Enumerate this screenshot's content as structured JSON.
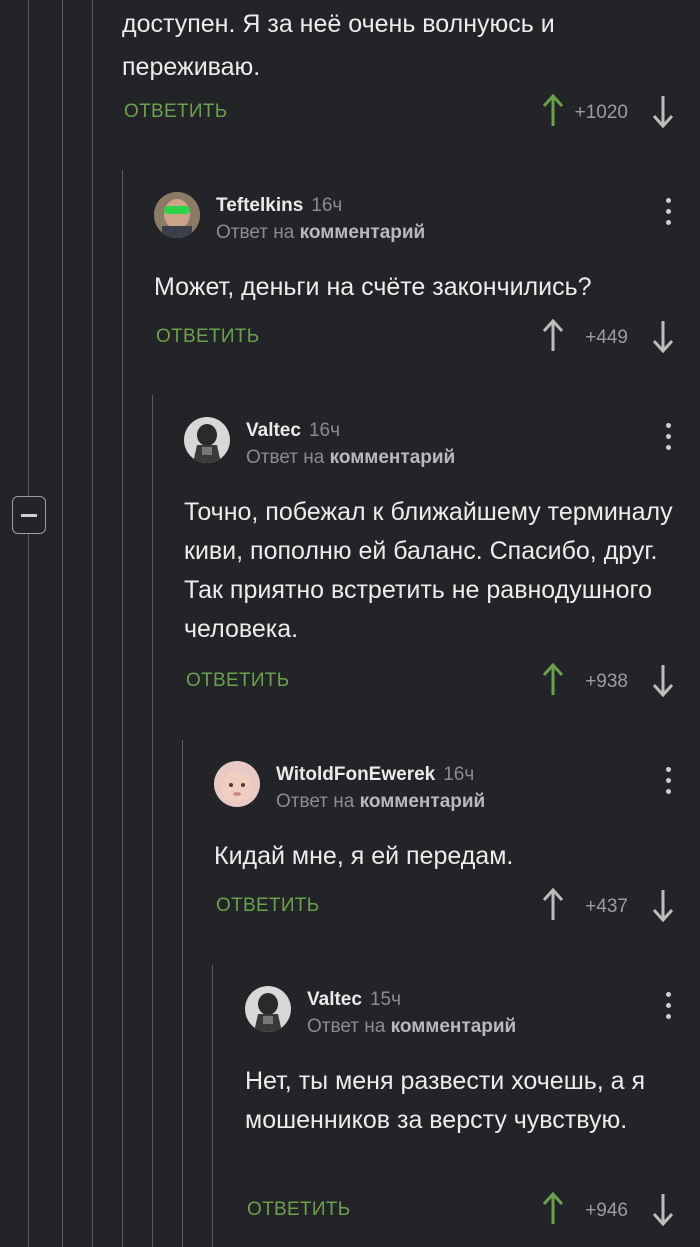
{
  "top_comment": {
    "text_lines": [
      "доступен. Я за неё очень волнуюсь и",
      "переживаю."
    ],
    "reply_label": "ОТВЕТИТЬ",
    "score": "+1020",
    "voted_up": true
  },
  "reply_to_label": "Ответ на",
  "reply_to_target": "комментарий",
  "comments": [
    {
      "author": "Teftelkins",
      "time": "16ч",
      "text": "Может, деньги на счёте закончились?",
      "reply_label": "ОТВЕТИТЬ",
      "score": "+449",
      "voted_up": false
    },
    {
      "author": "Valtec",
      "time": "16ч",
      "text": "Точно, побежал к ближайшему терминалу киви, пополню ей баланс. Спасибо, друг. Так приятно встретить не равнодушного человека.",
      "reply_label": "ОТВЕТИТЬ",
      "score": "+938",
      "voted_up": true
    },
    {
      "author": "WitoldFonEwerek",
      "time": "16ч",
      "text": "Кидай мне, я ей передам.",
      "reply_label": "ОТВЕТИТЬ",
      "score": "+437",
      "voted_up": false
    },
    {
      "author": "Valtec",
      "time": "15ч",
      "text": "Нет, ты меня развести хочешь, а я мошенников за версту чувствую.",
      "reply_label": "ОТВЕТИТЬ",
      "score": "+946",
      "voted_up": true
    }
  ],
  "colors": {
    "background": "#232427",
    "accent_green": "#6aa14c",
    "muted": "#8a8c90",
    "thread_line": "#5a5c60"
  }
}
